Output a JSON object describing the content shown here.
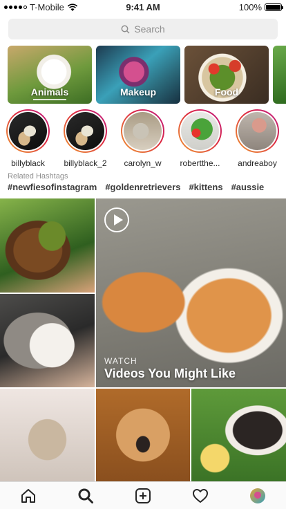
{
  "status_bar": {
    "carrier": "T-Mobile",
    "time": "9:41 AM",
    "battery": "100%",
    "battery_level": 1.0
  },
  "search": {
    "placeholder": "Search"
  },
  "categories": [
    {
      "label": "Animals"
    },
    {
      "label": "Makeup"
    },
    {
      "label": "Food"
    }
  ],
  "profiles": [
    {
      "username": "billyblack"
    },
    {
      "username": "billyblack_2"
    },
    {
      "username": "carolyn_w"
    },
    {
      "username": "robertthe..."
    },
    {
      "username": "andreaboy"
    }
  ],
  "related_hashtags": {
    "label": "Related Hashtags",
    "tags": [
      "#newfiesofinstagram",
      "#goldenretrievers",
      "#kittens",
      "#aussie"
    ]
  },
  "video_tile": {
    "overline": "WATCH",
    "title": "Videos You Might Like"
  },
  "nav": {
    "items": [
      "home-icon",
      "search-icon",
      "new-post-icon",
      "heart-icon",
      "profile-avatar"
    ]
  }
}
